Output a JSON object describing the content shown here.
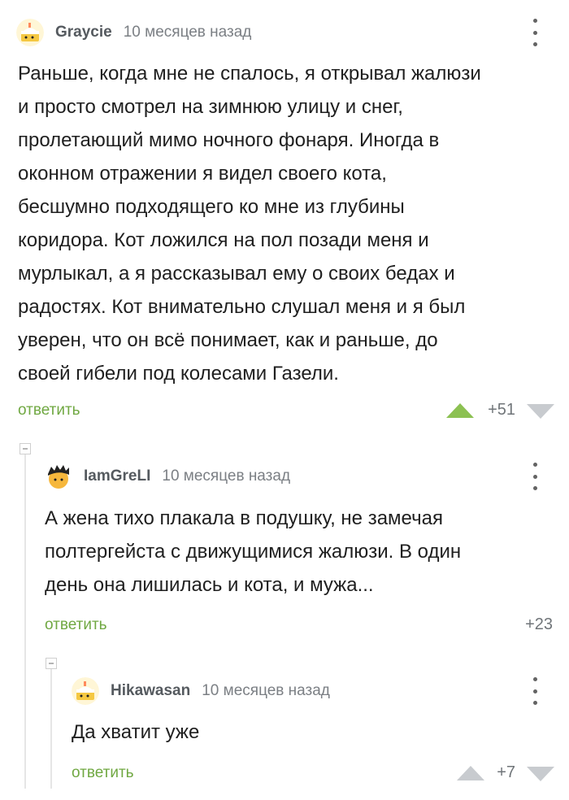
{
  "comments": [
    {
      "author": "Graycie",
      "time": "10 месяцев назад",
      "lines": [
        "Раньше, когда мне не спалось, я открывал жалюзи",
        "и просто смотрел на зимнюю улицу и снег,",
        "пролетающий мимо ночного фонаря. Иногда в",
        "оконном отражении я видел своего кота,",
        "бесшумно подходящего ко мне из глубины",
        "коридора. Кот ложился на пол позади меня и",
        "мурлыкал, а я рассказывал ему о своих бедах и",
        "радостях. Кот внимательно слушал меня и я был",
        "уверен, что он всё понимает, как и раньше, до",
        "своей гибели под колесами Газели."
      ],
      "reply_label": "ответить",
      "rating": "+51",
      "avatar": "cake-avatar"
    },
    {
      "author": "IamGreLI",
      "time": "10 месяцев назад",
      "lines": [
        "А жена тихо плакала в подушку, не замечая",
        "полтергейста с движущимися жалюзи. В один",
        "день она лишилась и кота, и мужа..."
      ],
      "reply_label": "ответить",
      "rating": "+23",
      "avatar": "dark-hair-avatar"
    },
    {
      "author": "Hikawasan",
      "time": "10 месяцев назад",
      "lines": [
        "Да хватит уже"
      ],
      "reply_label": "ответить",
      "rating": "+7",
      "avatar": "cake-avatar"
    }
  ],
  "colors": {
    "accent_green": "#70a842",
    "upvote_active": "#8cc152",
    "vote_inactive": "#c8cbcf",
    "meta_gray": "#7b7f84",
    "thread_line": "#e6e6e6"
  }
}
